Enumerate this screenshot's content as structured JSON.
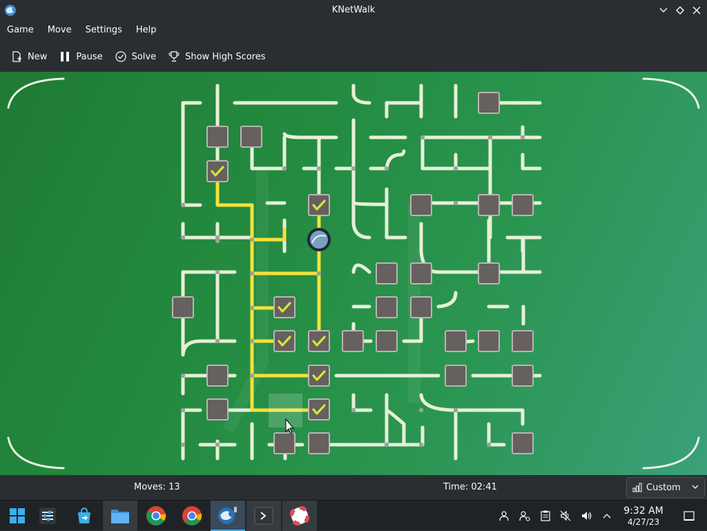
{
  "window": {
    "title": "KNetWalk"
  },
  "menu": [
    "Game",
    "Move",
    "Settings",
    "Help"
  ],
  "toolbar": {
    "new_label": "New",
    "pause_label": "Pause",
    "solve_label": "Solve",
    "high_scores_label": "Show High Scores"
  },
  "status": {
    "moves": "Moves: 13",
    "time": "Time: 02:41",
    "difficulty": "Custom"
  },
  "taskbar": {
    "apps": [
      "app-launcher-icon",
      "system-settings-icon",
      "discover-store-icon",
      "file-manager-icon",
      "chrome-icon",
      "chrome-icon",
      "knetwalk-icon",
      "konsole-icon",
      "help-center-icon"
    ],
    "clock_time": "9:32 AM",
    "clock_date": "4/27/23"
  },
  "colors": {
    "board_green": "#238a3f",
    "cable_off": "#e6f0d6",
    "cable_on": "#f5e13a",
    "terminal": "#66605f",
    "accent": "#3daee9"
  }
}
